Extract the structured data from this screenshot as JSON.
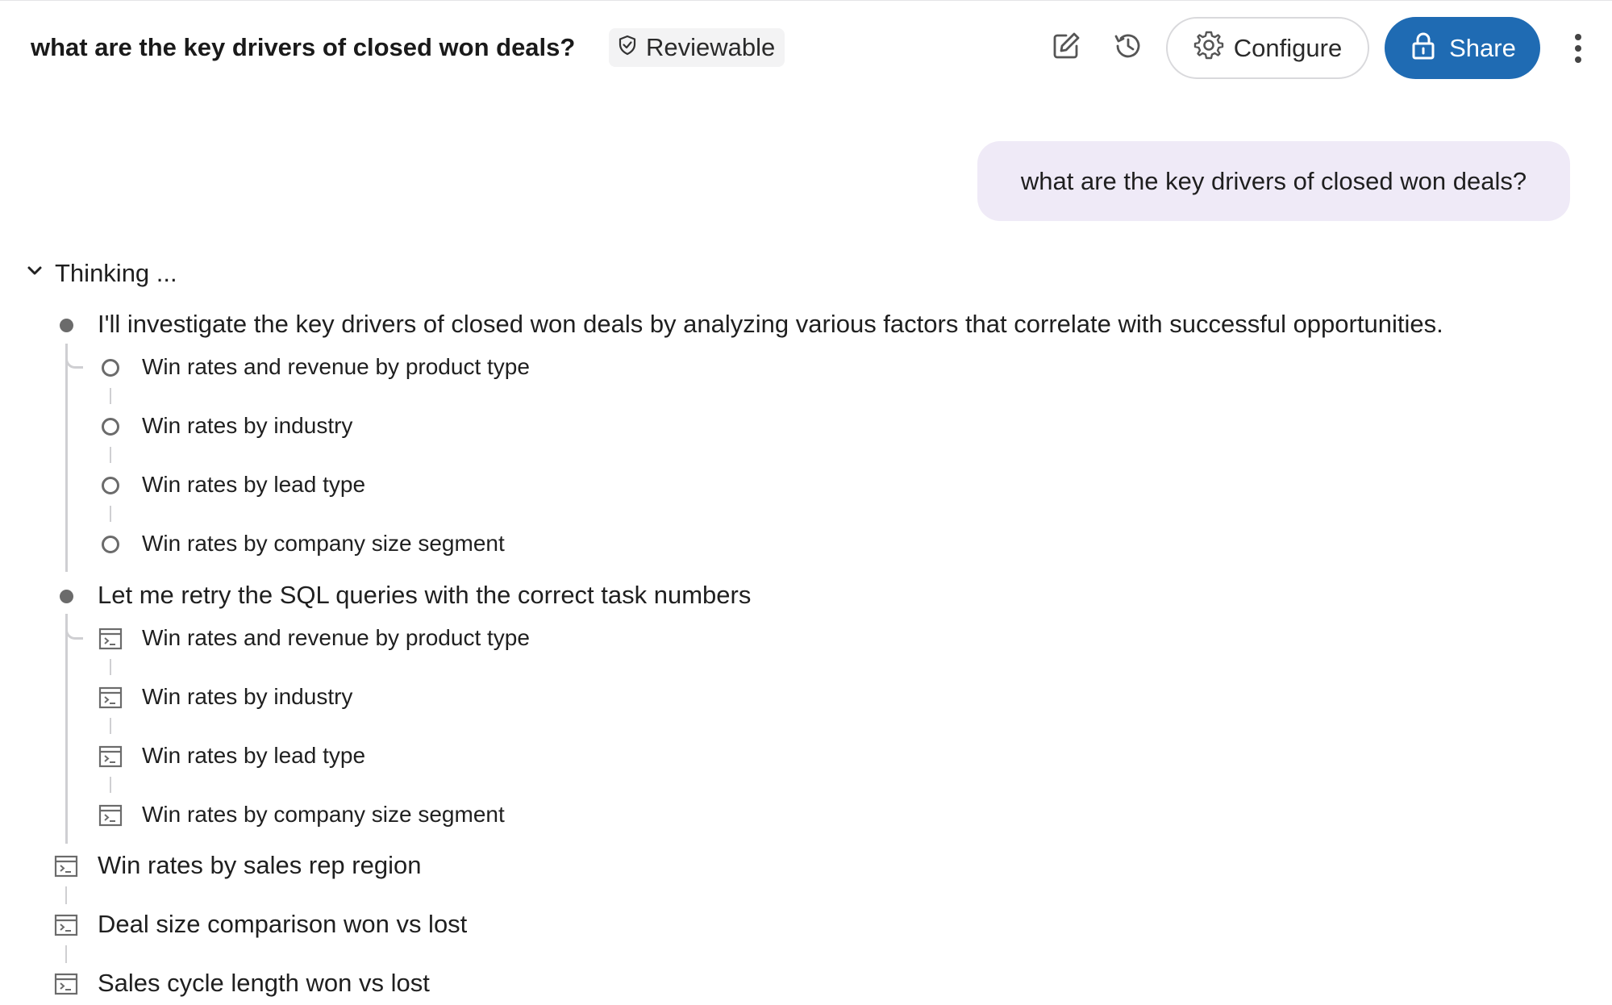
{
  "header": {
    "title": "what are the key drivers of closed won deals?",
    "badge_label": "Reviewable",
    "configure_label": "Configure",
    "share_label": "Share",
    "icons": {
      "badge": "shield-check-icon",
      "edit": "edit-icon",
      "history": "history-icon",
      "configure": "gear-icon",
      "share": "lock-icon",
      "more": "more-vertical-icon"
    },
    "colors": {
      "share_bg": "#1f6bb3",
      "bubble_bg": "#efeaf7"
    }
  },
  "user_message": "what are the key drivers of closed won deals?",
  "thinking": {
    "label": "Thinking ...",
    "steps": [
      {
        "text": "I'll investigate the key drivers of closed won deals by analyzing various factors that correlate with successful opportunities.",
        "children": [
          "Win rates and revenue by product type",
          "Win rates by industry",
          "Win rates by lead type",
          "Win rates by company size segment"
        ]
      },
      {
        "text": "Let me retry the SQL queries with the correct task numbers",
        "children": [
          "Win rates and revenue by product type",
          "Win rates by industry",
          "Win rates by lead type",
          "Win rates by company size segment"
        ]
      }
    ],
    "queries": [
      "Win rates by sales rep region",
      "Deal size comparison won vs lost",
      "Sales cycle length won vs lost"
    ]
  }
}
